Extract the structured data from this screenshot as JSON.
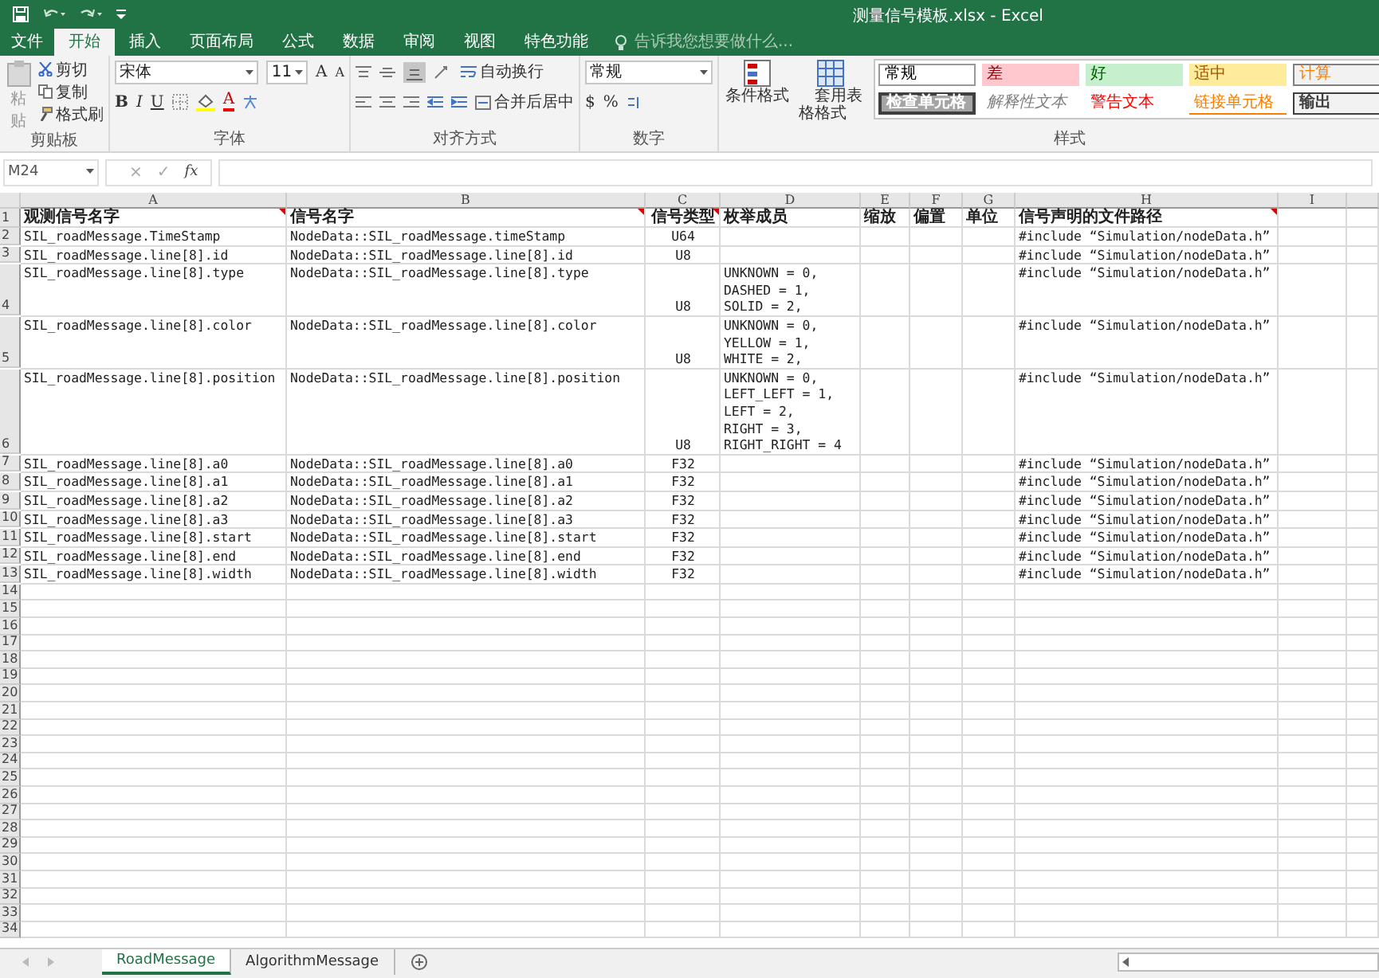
{
  "title_bar": {
    "title": "测量信号模板.xlsx - Excel"
  },
  "ribbon_tabs": [
    {
      "label": "文件",
      "selected": false
    },
    {
      "label": "开始",
      "selected": true
    },
    {
      "label": "插入",
      "selected": false
    },
    {
      "label": "页面布局",
      "selected": false
    },
    {
      "label": "公式",
      "selected": false
    },
    {
      "label": "数据",
      "selected": false
    },
    {
      "label": "审阅",
      "selected": false
    },
    {
      "label": "视图",
      "selected": false
    },
    {
      "label": "特色功能",
      "selected": false
    }
  ],
  "tell_me": {
    "placeholder": "告诉我您想要做什么..."
  },
  "clipboard": {
    "paste": "粘贴",
    "cut": "剪切",
    "copy": "复制",
    "format_painter": "格式刷",
    "label": "剪贴板"
  },
  "font": {
    "name": "宋体",
    "size": "11",
    "grow": "A",
    "shrink": "A",
    "bold": "B",
    "italic": "I",
    "underline": "U",
    "font_color": "A",
    "label": "字体"
  },
  "alignment": {
    "wrap": "自动换行",
    "merge": "合并后居中",
    "label": "对齐方式"
  },
  "number": {
    "format": "常规",
    "currency": "$",
    "percent": "%",
    "label": "数字"
  },
  "styles": {
    "conditional": "条件格式",
    "table_format": "套用表格格式",
    "label": "样式",
    "gallery": [
      {
        "label": "常规",
        "kind": "normal"
      },
      {
        "label": "差",
        "kind": "bad"
      },
      {
        "label": "好",
        "kind": "good"
      },
      {
        "label": "适中",
        "kind": "neutral"
      },
      {
        "label": "计算",
        "kind": "calculation"
      },
      {
        "label": "检查单元格",
        "kind": "check"
      },
      {
        "label": "解释性文本",
        "kind": "explanatory"
      },
      {
        "label": "警告文本",
        "kind": "warning"
      },
      {
        "label": "链接单元格",
        "kind": "linked"
      },
      {
        "label": "输出",
        "kind": "output"
      }
    ]
  },
  "formula_bar": {
    "name_box": "M24",
    "cancel": "×",
    "enter": "✓",
    "function": "fx"
  },
  "columns": [
    "A",
    "B",
    "C",
    "D",
    "E",
    "F",
    "G",
    "H",
    "I"
  ],
  "header_row": {
    "number": "1",
    "cells": {
      "A": {
        "text": "观测信号名字",
        "comment": true
      },
      "B": {
        "text": "信号名字",
        "comment": true
      },
      "C": {
        "text": "信号类型",
        "comment": true
      },
      "D": {
        "text": "枚举成员",
        "comment": false
      },
      "E": {
        "text": "缩放",
        "comment": false
      },
      "F": {
        "text": "偏置",
        "comment": false
      },
      "G": {
        "text": "单位",
        "comment": false
      },
      "H": {
        "text": "信号声明的文件路径",
        "comment": true
      }
    }
  },
  "rows": [
    {
      "number": "2",
      "A": "SIL_roadMessage.TimeStamp",
      "B": "NodeData::SIL_roadMessage.timeStamp",
      "C": "U64",
      "H": "#include “Simulation/nodeData.h”"
    },
    {
      "number": "3",
      "A": "SIL_roadMessage.line[8].id",
      "B": "NodeData::SIL_roadMessage.line[8].id",
      "C": "U8",
      "H": "#include “Simulation/nodeData.h”"
    },
    {
      "number": "4",
      "A": "SIL_roadMessage.line[8].type",
      "B": "NodeData::SIL_roadMessage.line[8].type",
      "C": "U8",
      "D": "UNKNOWN = 0,\nDASHED = 1,\nSOLID = 2,",
      "H": "#include “Simulation/nodeData.h”"
    },
    {
      "number": "5",
      "A": "SIL_roadMessage.line[8].color",
      "B": "NodeData::SIL_roadMessage.line[8].color",
      "C": "U8",
      "D": "UNKNOWN = 0,\nYELLOW = 1,\nWHITE = 2,",
      "H": "#include “Simulation/nodeData.h”"
    },
    {
      "number": "6",
      "A": "SIL_roadMessage.line[8].position",
      "B": "NodeData::SIL_roadMessage.line[8].position",
      "C": "U8",
      "D": "UNKNOWN = 0,\nLEFT_LEFT = 1,\nLEFT = 2,\nRIGHT = 3,\nRIGHT_RIGHT = 4",
      "H": "#include “Simulation/nodeData.h”"
    },
    {
      "number": "7",
      "A": "SIL_roadMessage.line[8].a0",
      "B": "NodeData::SIL_roadMessage.line[8].a0",
      "C": "F32",
      "H": "#include “Simulation/nodeData.h”"
    },
    {
      "number": "8",
      "A": "SIL_roadMessage.line[8].a1",
      "B": "NodeData::SIL_roadMessage.line[8].a1",
      "C": "F32",
      "H": "#include “Simulation/nodeData.h”"
    },
    {
      "number": "9",
      "A": "SIL_roadMessage.line[8].a2",
      "B": "NodeData::SIL_roadMessage.line[8].a2",
      "C": "F32",
      "H": "#include “Simulation/nodeData.h”"
    },
    {
      "number": "10",
      "A": "SIL_roadMessage.line[8].a3",
      "B": "NodeData::SIL_roadMessage.line[8].a3",
      "C": "F32",
      "H": "#include “Simulation/nodeData.h”"
    },
    {
      "number": "11",
      "A": "SIL_roadMessage.line[8].start",
      "B": "NodeData::SIL_roadMessage.line[8].start",
      "C": "F32",
      "H": "#include “Simulation/nodeData.h”"
    },
    {
      "number": "12",
      "A": "SIL_roadMessage.line[8].end",
      "B": "NodeData::SIL_roadMessage.line[8].end",
      "C": "F32",
      "H": "#include “Simulation/nodeData.h”"
    },
    {
      "number": "13",
      "A": "SIL_roadMessage.line[8].width",
      "B": "NodeData::SIL_roadMessage.line[8].width",
      "C": "F32",
      "H": "#include “Simulation/nodeData.h”"
    },
    {
      "number": "14"
    },
    {
      "number": "15"
    },
    {
      "number": "16"
    },
    {
      "number": "17"
    },
    {
      "number": "18"
    },
    {
      "number": "19"
    },
    {
      "number": "20"
    },
    {
      "number": "21"
    },
    {
      "number": "22"
    },
    {
      "number": "23"
    },
    {
      "number": "24"
    },
    {
      "number": "25"
    },
    {
      "number": "26"
    },
    {
      "number": "27"
    },
    {
      "number": "28"
    },
    {
      "number": "29"
    },
    {
      "number": "30"
    },
    {
      "number": "31"
    },
    {
      "number": "32"
    },
    {
      "number": "33"
    },
    {
      "number": "34"
    }
  ],
  "sheet_tabs": [
    {
      "label": "RoadMessage",
      "selected": true
    },
    {
      "label": "AlgorithmMessage",
      "selected": false
    }
  ]
}
